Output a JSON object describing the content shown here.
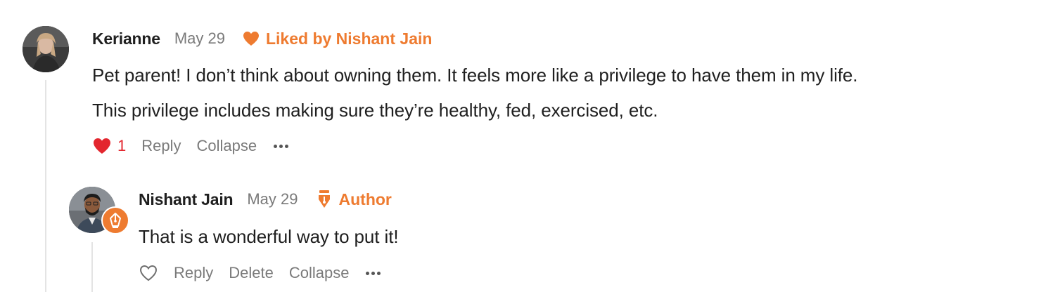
{
  "colors": {
    "accent": "#ee7b30",
    "like_red": "#e3262e",
    "muted_text": "#7a7a7a",
    "body_text": "#1f1f1f",
    "thread_line": "#e4e4e4"
  },
  "parent_comment": {
    "author": "Kerianne",
    "date": "May 29",
    "liked_by_icon": "heart-icon",
    "liked_by": "Liked by Nishant Jain",
    "text_line_1": "Pet parent! I don’t think about owning them. It feels more like a privilege to have them in my life.",
    "text_line_2": "This privilege includes making sure they’re healthy, fed, exercised, etc.",
    "actions": {
      "like_icon": "heart-filled-icon",
      "like_count": "1",
      "reply_label": "Reply",
      "collapse_label": "Collapse",
      "more_icon": "more-dots-icon"
    }
  },
  "reply_comment": {
    "author": "Nishant Jain",
    "date": "May 29",
    "badge_icon": "pen-nib-icon",
    "badge_label": "Author",
    "text": "That is a wonderful way to put it!",
    "actions": {
      "like_icon": "heart-outline-icon",
      "reply_label": "Reply",
      "delete_label": "Delete",
      "collapse_label": "Collapse",
      "more_icon": "more-dots-icon"
    }
  }
}
